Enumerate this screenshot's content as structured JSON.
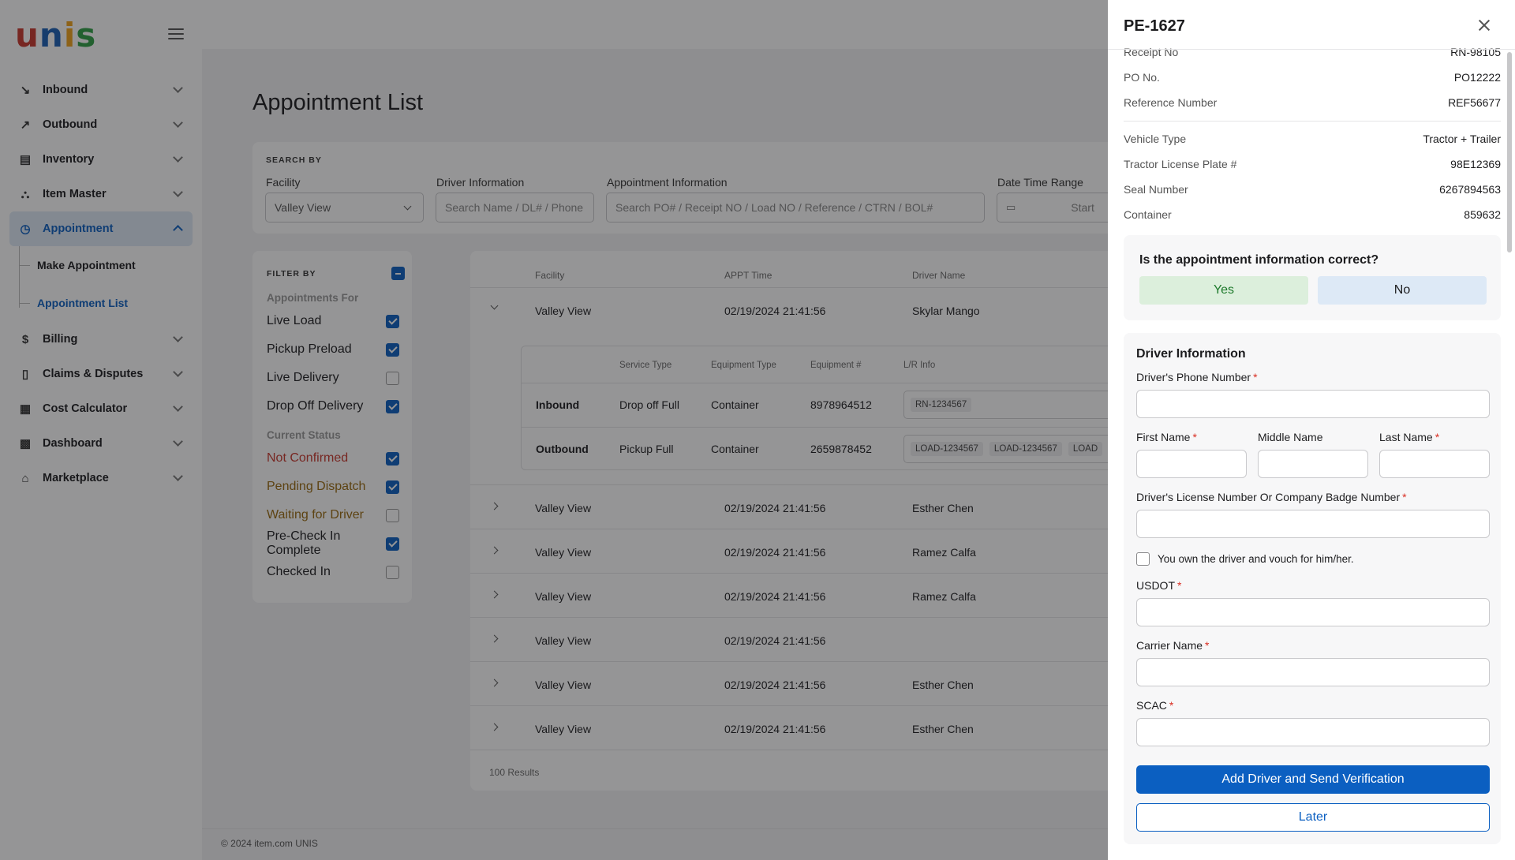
{
  "brand": {
    "logo_letters": [
      "u",
      "n",
      "i",
      "s"
    ],
    "logo_colors": [
      "#c8372d",
      "#1a5fb4",
      "#f0a21b",
      "#2f9e44"
    ]
  },
  "sidebar": {
    "items": [
      {
        "label": "Inbound",
        "icon": "inbound-icon"
      },
      {
        "label": "Outbound",
        "icon": "outbound-icon"
      },
      {
        "label": "Inventory",
        "icon": "inventory-icon"
      },
      {
        "label": "Item Master",
        "icon": "item-master-icon"
      },
      {
        "label": "Appointment",
        "icon": "clock-icon"
      },
      {
        "label": "Billing",
        "icon": "dollar-icon"
      },
      {
        "label": "Claims & Disputes",
        "icon": "document-icon"
      },
      {
        "label": "Cost Calculator",
        "icon": "calculator-icon"
      },
      {
        "label": "Dashboard",
        "icon": "dashboard-icon"
      },
      {
        "label": "Marketplace",
        "icon": "store-icon"
      }
    ],
    "subitems": [
      {
        "label": "Make Appointment"
      },
      {
        "label": "Appointment List"
      }
    ]
  },
  "page": {
    "title": "Appointment List",
    "footer": "© 2024 item.com UNIS"
  },
  "search": {
    "heading": "SEARCH BY",
    "facility_label": "Facility",
    "facility_value": "Valley View",
    "driver_label": "Driver Information",
    "driver_placeholder": "Search Name / DL# / Phone",
    "appt_label": "Appointment Information",
    "appt_placeholder": "Search PO# / Receipt NO / Load NO / Reference / CTRN / BOL#",
    "date_label": "Date Time Range",
    "date_placeholder": "Start"
  },
  "filters": {
    "heading": "FILTER BY",
    "group1": "Appointments For",
    "group1_items": [
      {
        "label": "Live Load",
        "checked": true
      },
      {
        "label": "Pickup Preload",
        "checked": true
      },
      {
        "label": "Live Delivery",
        "checked": false
      },
      {
        "label": "Drop Off Delivery",
        "checked": true
      }
    ],
    "group2": "Current Status",
    "group2_items": [
      {
        "label": "Not Confirmed",
        "checked": true,
        "color": "#c8372d"
      },
      {
        "label": "Pending Dispatch",
        "checked": true,
        "color": "#9a6a10"
      },
      {
        "label": "Waiting for Driver",
        "checked": false,
        "color": "#9a6a10"
      },
      {
        "label": "Pre-Check In Complete",
        "checked": true,
        "color": "#1d1d1f"
      },
      {
        "label": "Checked In",
        "checked": false,
        "color": "#1d1d1f"
      }
    ]
  },
  "table": {
    "headers": {
      "facility": "Facility",
      "appt_time": "APPT Time",
      "driver": "Driver Name"
    },
    "rows": [
      {
        "facility": "Valley View",
        "time": "02/19/2024 21:41:56",
        "driver": "Skylar Mango"
      },
      {
        "facility": "Valley View",
        "time": "02/19/2024 21:41:56",
        "driver": "Esther Chen"
      },
      {
        "facility": "Valley View",
        "time": "02/19/2024 21:41:56",
        "driver": "Ramez Calfa"
      },
      {
        "facility": "Valley View",
        "time": "02/19/2024 21:41:56",
        "driver": "Ramez Calfa"
      },
      {
        "facility": "Valley View",
        "time": "02/19/2024 21:41:56",
        "driver": ""
      },
      {
        "facility": "Valley View",
        "time": "02/19/2024 21:41:56",
        "driver": "Esther Chen"
      },
      {
        "facility": "Valley View",
        "time": "02/19/2024 21:41:56",
        "driver": "Esther Chen"
      }
    ],
    "nested": {
      "headers": {
        "service": "Service Type",
        "equipment_type": "Equipment Type",
        "equipment_no": "Equipment #",
        "lr": "L/R Info"
      },
      "rows": [
        {
          "direction": "Inbound",
          "service": "Drop off Full",
          "equipment_type": "Container",
          "equipment_no": "8978964512",
          "tags": [
            "RN-1234567"
          ]
        },
        {
          "direction": "Outbound",
          "service": "Pickup Full",
          "equipment_type": "Container",
          "equipment_no": "2659878452",
          "tags": [
            "LOAD-1234567",
            "LOAD-1234567",
            "LOAD"
          ]
        }
      ]
    },
    "results": "100 Results"
  },
  "drawer": {
    "title": "PE-1627",
    "fields": [
      {
        "label": "Receipt No",
        "value": "RN-98105"
      },
      {
        "label": "PO No.",
        "value": "PO12222"
      },
      {
        "label": "Reference Number",
        "value": "REF56677"
      },
      {
        "label": "Vehicle Type",
        "value": "Tractor + Trailer"
      },
      {
        "label": "Tractor License Plate #",
        "value": "98E12369"
      },
      {
        "label": "Seal Number",
        "value": "6267894563"
      },
      {
        "label": "Container",
        "value": "859632"
      }
    ],
    "confirm": {
      "question": "Is the appointment information correct?",
      "yes": "Yes",
      "no": "No"
    },
    "driver": {
      "title": "Driver Information",
      "phone_label": "Driver's Phone Number",
      "first_label": "First Name",
      "middle_label": "Middle Name",
      "last_label": "Last Name",
      "license_label": "Driver's License Number Or Company Badge Number",
      "own_label": "You own the driver and vouch for him/her.",
      "usdot_label": "USDOT",
      "carrier_label": "Carrier Name",
      "scac_label": "SCAC",
      "required_mark": "*",
      "submit": "Add Driver and Send Verification",
      "later": "Later"
    }
  }
}
